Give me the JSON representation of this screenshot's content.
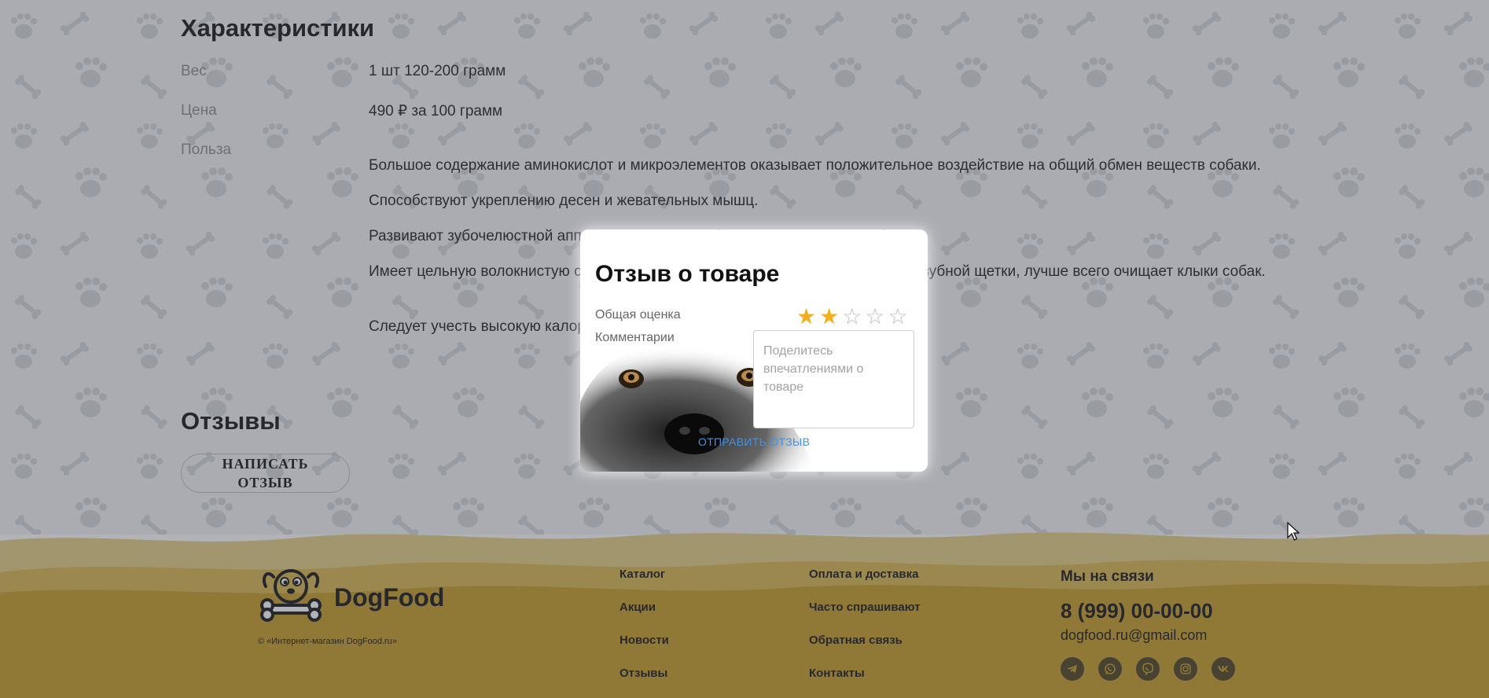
{
  "characteristics": {
    "title": "Характеристики",
    "rows": [
      {
        "label": "Вес",
        "value": "1 шт 120-200 грамм"
      },
      {
        "label": "Цена",
        "value": "490 ₽ за 100 грамм"
      },
      {
        "label": "Польза",
        "value": ""
      }
    ],
    "benefits": [
      "Большое содержание аминокислот и микроэлементов оказывает положительное воздействие на общий обмен веществ собаки.",
      "Способствуют укреплению десен и жевательных мышц.",
      "Развивают зубочелюстной аппарат, отвлекают собаку во время смены зубов.",
      "Имеет цельную волокнистую структуру, при разжевывание получается эффект зубной щетки, лучше всего очищает клыки собак.",
      "Следует учесть высокую калорийность продукта."
    ]
  },
  "reviews": {
    "title": "Отзывы",
    "write_button": "НАПИСАТЬ ОТЗЫВ"
  },
  "modal": {
    "title": "Отзыв о товаре",
    "rating_label": "Общая оценка",
    "rating_value": 2,
    "rating_max": 5,
    "comment_label": "Комментарии",
    "comment_placeholder": "Поделитесь впечатлениями о товаре",
    "comment_value": "",
    "submit_label": "ОТПРАВИТЬ ОТЗЫВ"
  },
  "footer": {
    "brand": "DogFood",
    "copyright": "© «Интернет-магазин DogFood.ru»",
    "links_col1": [
      "Каталог",
      "Акции",
      "Новости",
      "Отзывы"
    ],
    "links_col2": [
      "Оплата и доставка",
      "Часто спрашивают",
      "Обратная связь",
      "Контакты"
    ],
    "contacts_title": "Мы на связи",
    "phone": "8 (999) 00-00-00",
    "email": "dogfood.ru@gmail.com",
    "social_icons": [
      "telegram-icon",
      "whatsapp-icon",
      "viber-icon",
      "instagram-icon",
      "vk-icon"
    ]
  },
  "colors": {
    "accent": "#f2b01e",
    "footer_sand": "#d9b64a",
    "footer_dark": "#b88a1e",
    "link": "#4a90d9"
  }
}
